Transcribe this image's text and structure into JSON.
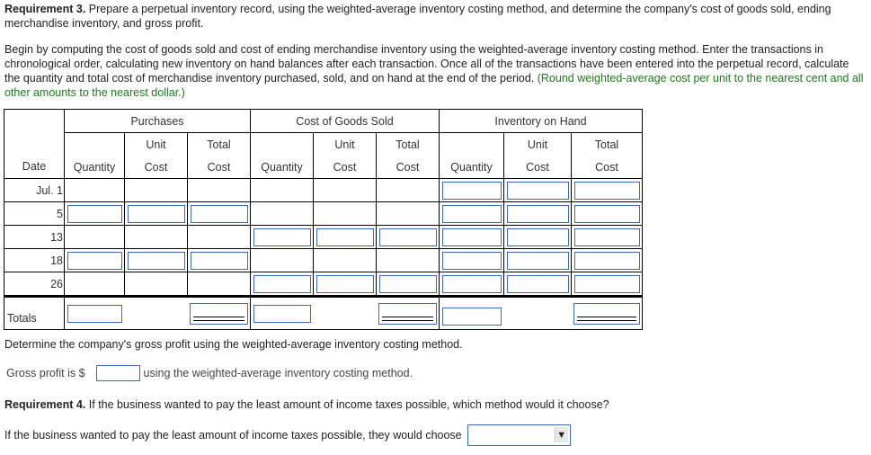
{
  "requirement3": {
    "label": "Requirement 3.",
    "text": " Prepare a perpetual inventory record, using the weighted-average inventory costing method, and determine the company's cost of goods sold, ending merchandise inventory, and gross profit."
  },
  "instructions": {
    "text": "Begin by computing the cost of goods sold and cost of ending merchandise inventory using the weighted-average inventory costing method. Enter the transactions in chronological order, calculating new inventory on hand balances after each transaction. Once all of the transactions have been entered into the perpetual record, calculate the quantity and total cost of merchandise inventory purchased, sold, and on hand at the end of the period. ",
    "note": "(Round weighted-average cost per unit to the nearest cent and all other amounts to the nearest dollar.)",
    "note_color": "#1e7a1e"
  },
  "table": {
    "groups": [
      "Purchases",
      "Cost of Goods Sold",
      "Inventory on Hand"
    ],
    "date_header": "Date",
    "sub_top": [
      "",
      "Unit",
      "Total",
      "",
      "Unit",
      "Total",
      "",
      "Unit",
      "Total"
    ],
    "sub_bottom": [
      "Quantity",
      "Cost",
      "Cost",
      "Quantity",
      "Cost",
      "Cost",
      "Quantity",
      "Cost",
      "Cost"
    ],
    "rows": [
      {
        "date": "Jul. 1",
        "inputs": [
          false,
          false,
          false,
          false,
          false,
          false,
          true,
          true,
          true
        ]
      },
      {
        "date": "5",
        "inputs": [
          true,
          true,
          true,
          false,
          false,
          false,
          true,
          true,
          true
        ]
      },
      {
        "date": "13",
        "inputs": [
          false,
          false,
          false,
          true,
          true,
          true,
          true,
          true,
          true
        ]
      },
      {
        "date": "18",
        "inputs": [
          true,
          true,
          true,
          false,
          false,
          false,
          true,
          true,
          true
        ]
      },
      {
        "date": "26",
        "inputs": [
          false,
          false,
          false,
          true,
          true,
          true,
          true,
          true,
          true
        ]
      }
    ],
    "totals_label": "Totals"
  },
  "gross_profit": {
    "question": "Determine the company's gross profit using the weighted-average inventory costing method.",
    "prefix": "Gross profit is $",
    "value": "",
    "suffix": "using the weighted-average inventory costing method."
  },
  "requirement4": {
    "label": "Requirement 4.",
    "text": " If the business wanted to pay the least amount of income taxes possible, which method would it choose?",
    "answer_prefix": "If the business wanted to pay the least amount of income taxes possible, they would choose",
    "selected": "",
    "arrow_icon": "▼"
  },
  "colors": {
    "input_border": "#3a6bc4"
  }
}
